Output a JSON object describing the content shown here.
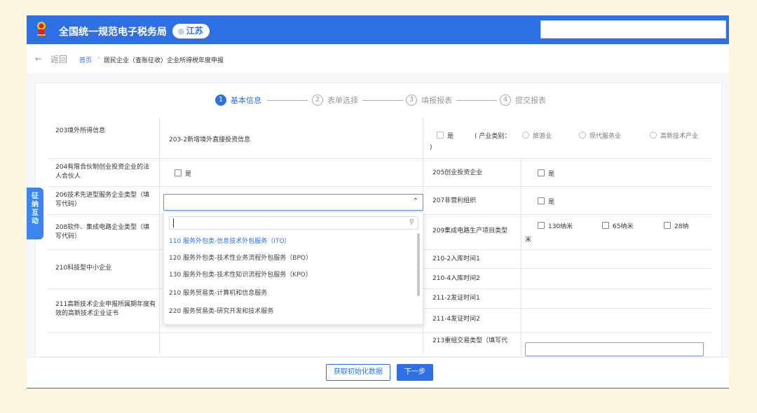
{
  "header": {
    "title": "全国统一规范电子税务局",
    "region": "江苏"
  },
  "breadcrumb": {
    "back": "返回",
    "home": "首页",
    "separator": "›",
    "current": "居民企业（查账征收）企业所得税年度申报"
  },
  "steps": [
    {
      "num": "1",
      "label": "基本信息",
      "active": true
    },
    {
      "num": "2",
      "label": "表单选择",
      "active": false
    },
    {
      "num": "3",
      "label": "填报报表",
      "active": false
    },
    {
      "num": "4",
      "label": "提交报表",
      "active": false
    }
  ],
  "form": {
    "row203": {
      "label": "203境外所得信息",
      "sub_label": "203-2新增境外直接投资信息",
      "yes": "是",
      "industry_prefix": "( 产业类别：",
      "opt_tourism": "旅游业",
      "opt_modern": "现代服务业",
      "opt_hightech": "高新技术产业",
      "close_paren": ")"
    },
    "row204": {
      "label": "204有限合伙制创业投资企业的法人合伙人",
      "yes": "是"
    },
    "row205": {
      "label": "205创业投资企业",
      "yes": "是"
    },
    "row206": {
      "label": "206技术先进型服务企业类型（填写代码）"
    },
    "row207": {
      "label": "207非营利组织",
      "yes": "是"
    },
    "row208": {
      "label": "208软件、集成电路企业类型（填写代码）"
    },
    "row209": {
      "label": "209集成电路生产项目类型",
      "opt1": "130纳米",
      "opt2": "65纳米",
      "opt3": "28纳",
      "opt3_wrap": "米"
    },
    "row210": {
      "label": "210科技型中小企业",
      "sub1": "210-2入库时间1",
      "sub2": "210-4入库时间2"
    },
    "row211": {
      "label": "211高新技术企业申报所属期年度有效的高新技术企业证书",
      "sub1": "211-2发证时间1",
      "sub2": "211-4发证时间2"
    },
    "row213": {
      "label": "213重组交易类型（填写代",
      "left_label": "..."
    }
  },
  "dropdown": {
    "search_placeholder": "",
    "items": [
      {
        "text": "110 服务外包类-信息技术外包服务（ITO）",
        "selected": true
      },
      {
        "text": "120 服务外包类-技术性业务流程外包服务（BPO）",
        "selected": false
      },
      {
        "text": "130 服务外包类-技术性知识流程外包服务（KPO）",
        "selected": false
      },
      {
        "text": "210 服务贸易类-计算机和信息服务",
        "selected": false
      },
      {
        "text": "220 服务贸易类-研究开发和技术服务",
        "selected": false
      }
    ]
  },
  "side_tab": {
    "label": "征纳互动"
  },
  "footer": {
    "init_button": "获取初始化数据",
    "next_button": "下一步"
  },
  "colors": {
    "brand": "#2f6fe4",
    "page_bg": "#fbf6df"
  }
}
